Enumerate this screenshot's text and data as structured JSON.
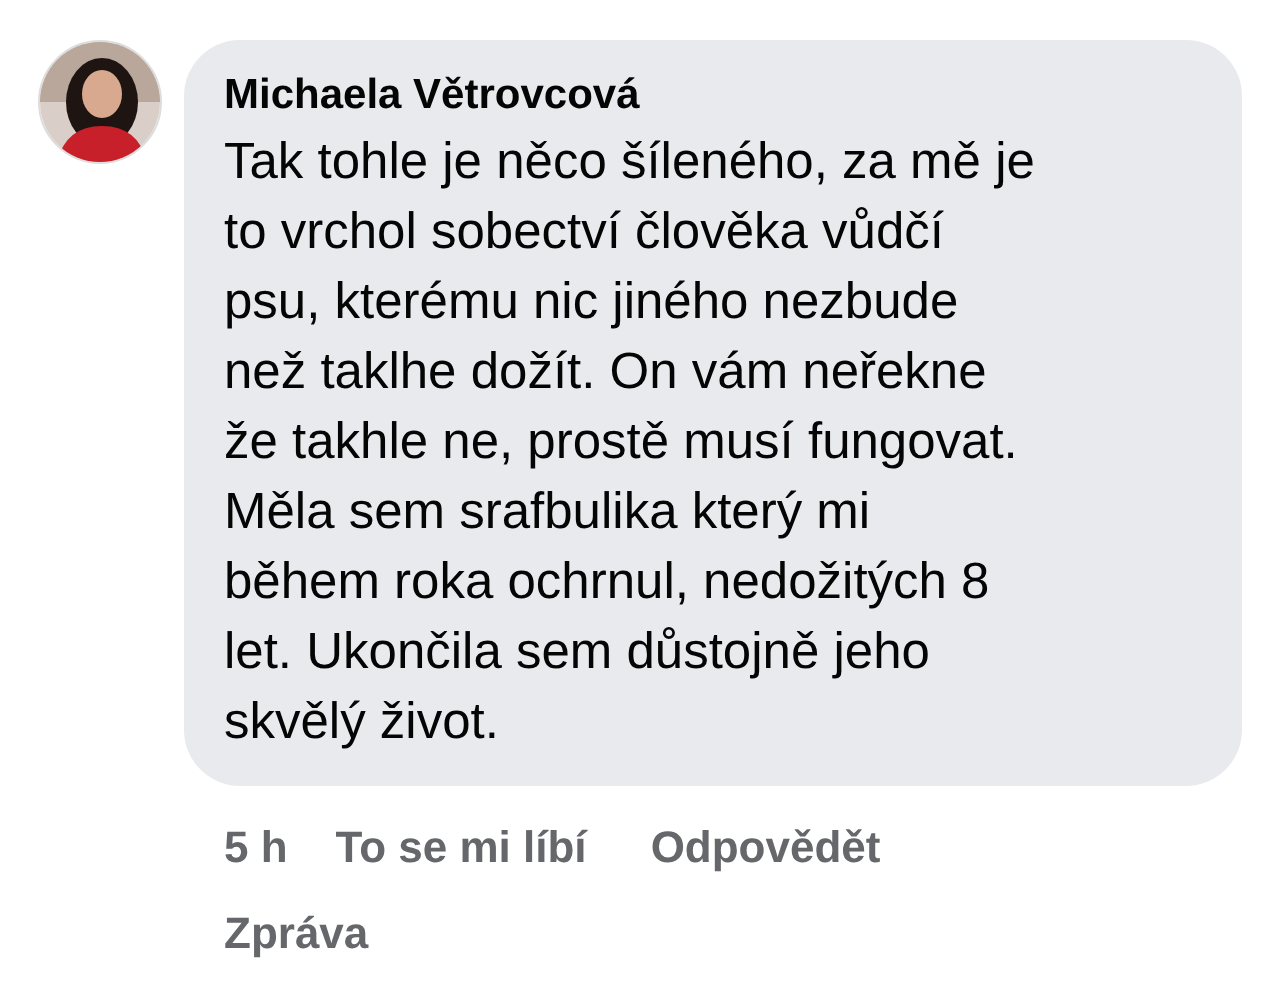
{
  "comment": {
    "author": "Michaela Větrovcová",
    "lines": [
      "Tak tohle je něco šíleného, za mě je",
      "to vrchol sobectví člověka vůdčí",
      "psu, kterému nic jiného nezbude",
      "než taklhe dožít. On vám neřekne",
      "že takhle ne, prostě musí fungovat.",
      "Měla sem srafbulika který mi",
      "během roka ochrnul, nedožitých 8",
      "let. Ukončila sem důstojně jeho",
      "skvělý život."
    ]
  },
  "actions": [
    {
      "kind": "time",
      "label": "5 h"
    },
    {
      "kind": "link",
      "label": "To se mi líbí"
    },
    {
      "kind": "link",
      "label": "Odpovědět"
    },
    {
      "kind": "link",
      "label": "Zpráva"
    }
  ]
}
